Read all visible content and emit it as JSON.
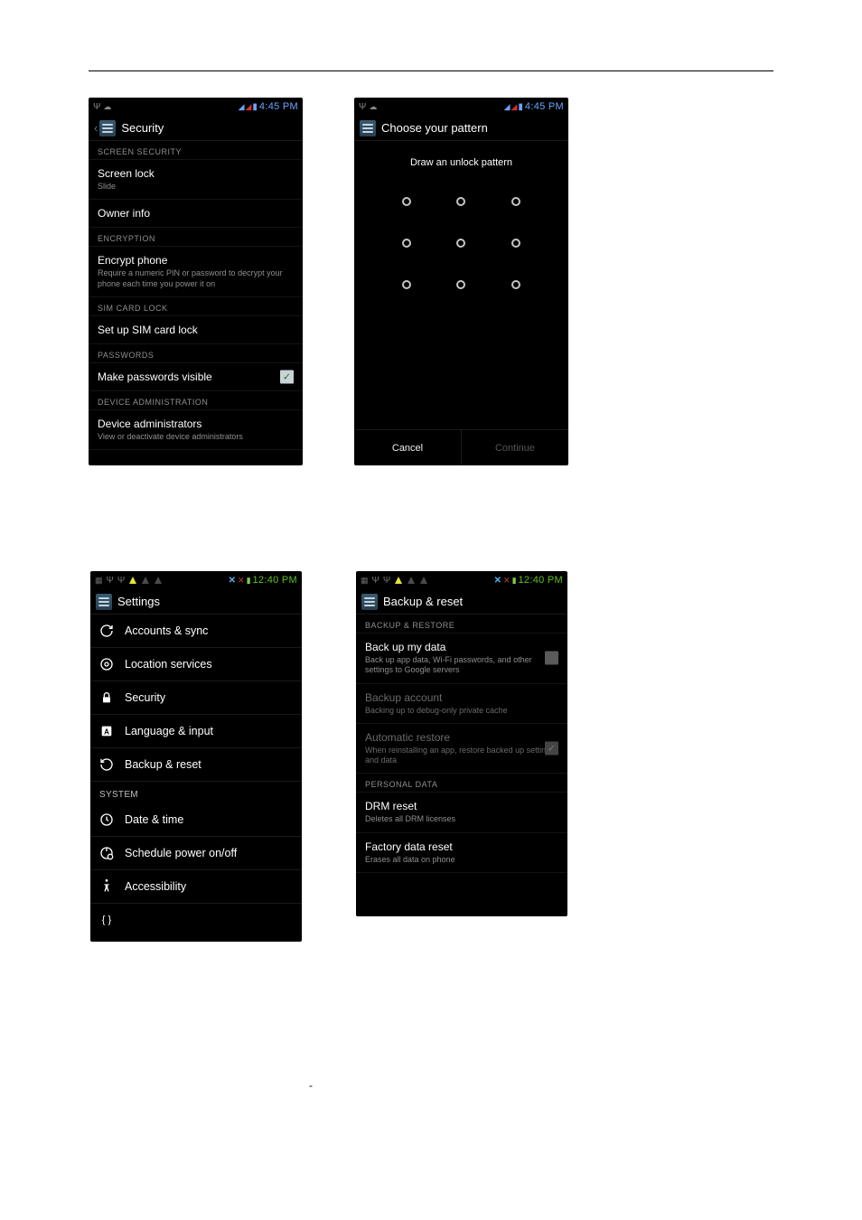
{
  "statusbar": {
    "time_445": "4:45 PM",
    "time_1240": "12:40 PM"
  },
  "security": {
    "header": "Security",
    "section_screen": "SCREEN SECURITY",
    "screen_lock_title": "Screen lock",
    "screen_lock_sub": "Slide",
    "owner_info": "Owner info",
    "section_encryption": "ENCRYPTION",
    "encrypt_title": "Encrypt phone",
    "encrypt_sub": "Require a numeric PIN or password to decrypt your phone each time you power it on",
    "section_sim": "SIM CARD LOCK",
    "sim_lock": "Set up SIM card lock",
    "section_passwords": "PASSWORDS",
    "pw_visible": "Make passwords visible",
    "section_device_admin": "DEVICE ADMINISTRATION",
    "device_admin_title": "Device administrators",
    "device_admin_sub": "View or deactivate device administrators"
  },
  "pattern": {
    "header": "Choose your pattern",
    "instruction": "Draw an unlock pattern",
    "cancel": "Cancel",
    "continue": "Continue"
  },
  "settings_list": {
    "header": "Settings",
    "items": {
      "accounts": "Accounts & sync",
      "location": "Location services",
      "security": "Security",
      "language": "Language & input",
      "backup": "Backup & reset",
      "datetime": "Date & time",
      "schedule": "Schedule power on/off",
      "accessibility": "Accessibility"
    },
    "system_header": "SYSTEM"
  },
  "backup": {
    "header": "Backup & reset",
    "section_br": "BACKUP & RESTORE",
    "backup_data_title": "Back up my data",
    "backup_data_sub": "Back up app data, Wi-Fi passwords, and other settings to Google servers",
    "backup_acct_title": "Backup account",
    "backup_acct_sub": "Backing up to debug-only private cache",
    "auto_restore_title": "Automatic restore",
    "auto_restore_sub": "When reinstalling an app, restore backed up settings and data",
    "section_personal": "PERSONAL DATA",
    "drm_title": "DRM reset",
    "drm_sub": "Deletes all DRM licenses",
    "factory_title": "Factory data reset",
    "factory_sub": "Erases all data on phone"
  },
  "page_dash": "-"
}
